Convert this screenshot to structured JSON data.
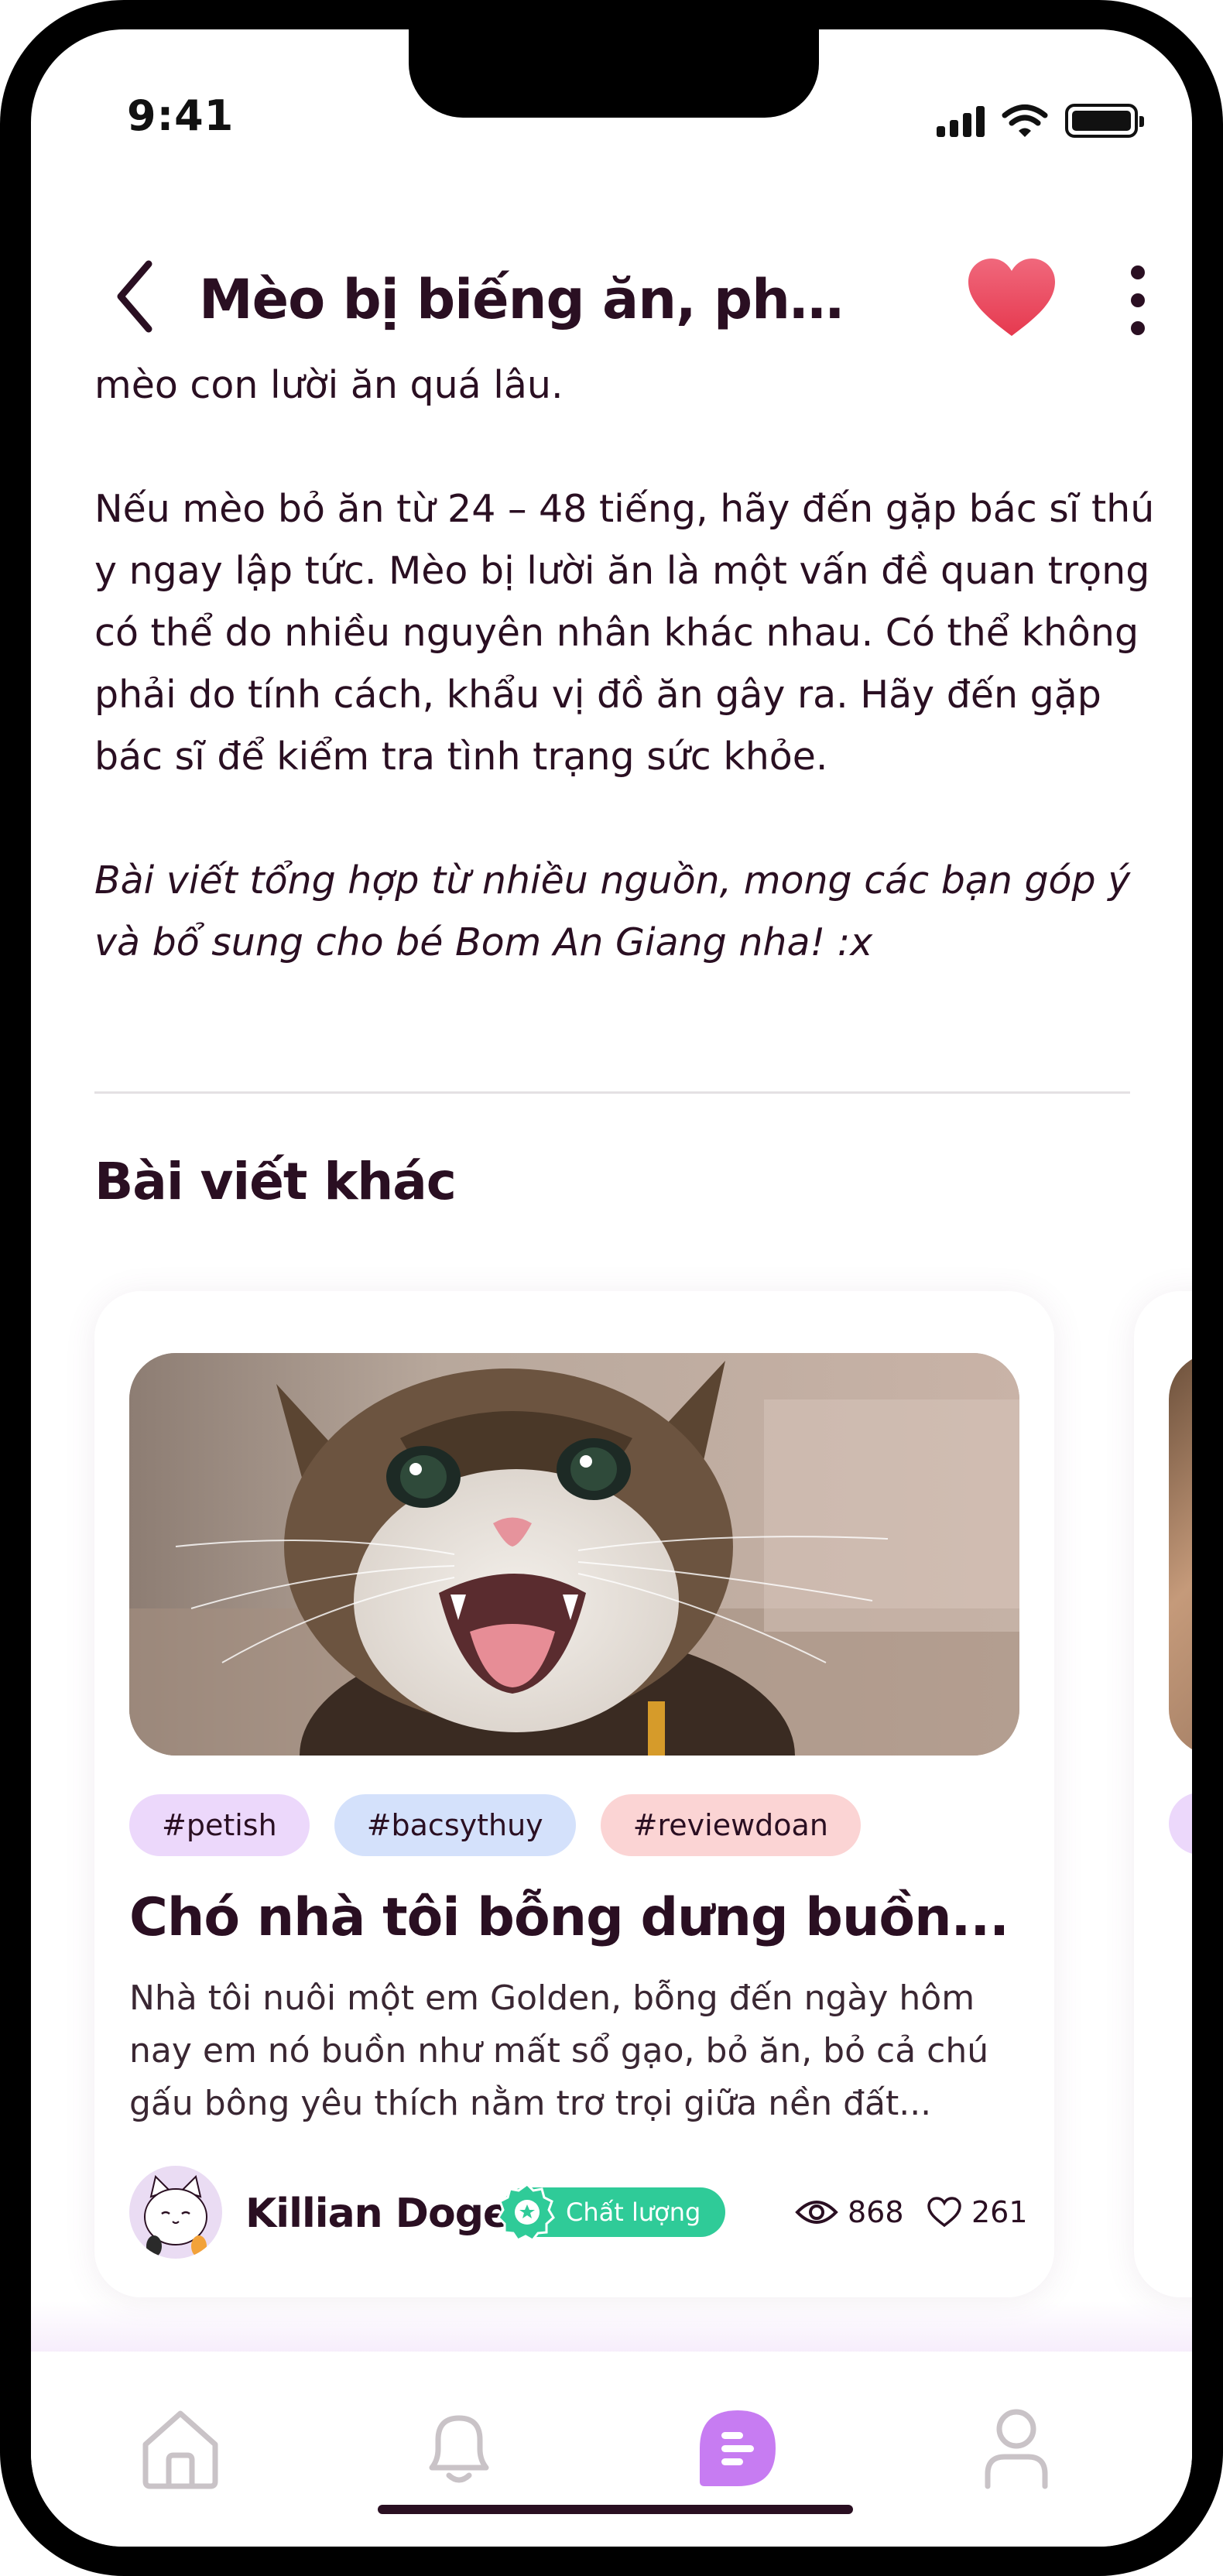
{
  "status_bar": {
    "time": "9:41"
  },
  "header": {
    "title": "Mèo bị biếng ăn, phải làm...",
    "back_icon": "chevron-left-icon",
    "favorite_icon": "heart-icon",
    "favorite_color": "#ee4f68",
    "more_icon": "more-vertical-icon"
  },
  "article": {
    "paragraphs": [
      "mèo con lười ăn quá lâu.",
      "Nếu mèo bỏ ăn từ 24 – 48 tiếng, hãy đến gặp bác sĩ thú y ngay lập tức. Mèo bị lười ăn là một vấn đề quan trọng có thể do nhiều nguyên nhân khác nhau. Có thể không phải do tính cách, khẩu vị đồ ăn gây ra. Hãy đến gặp bác sĩ để kiểm tra tình trạng sức khỏe."
    ],
    "closing_note": "Bài viết tổng hợp từ nhiều nguồn, mong các bạn góp ý và bổ sung cho bé Bom An Giang nha! :x"
  },
  "related": {
    "section_title": "Bài viết khác",
    "posts": [
      {
        "tags": [
          "#petish",
          "#bacsythuy",
          "#reviewdoan"
        ],
        "title": "Chó nhà tôi bỗng dưng buồn...",
        "excerpt": "Nhà tôi nuôi một em Golden, bỗng đến ngày hôm nay em nó buồn như mất sổ gạo, bỏ ăn, bỏ cả chú gấu bông yêu thích nằm trơ trọi giữa nền đất...",
        "author": "Killian Doge",
        "badge": "Chất lượng",
        "views": "868",
        "likes": "261"
      }
    ]
  },
  "tab_bar": {
    "tabs": [
      {
        "name": "home",
        "icon": "home-icon",
        "active": false
      },
      {
        "name": "notifications",
        "icon": "bell-icon",
        "active": false
      },
      {
        "name": "posts",
        "icon": "posts-icon",
        "active": true
      },
      {
        "name": "profile",
        "icon": "user-icon",
        "active": false
      }
    ],
    "active_color": "#c77cf2",
    "inactive_color": "#c9c3c7"
  }
}
